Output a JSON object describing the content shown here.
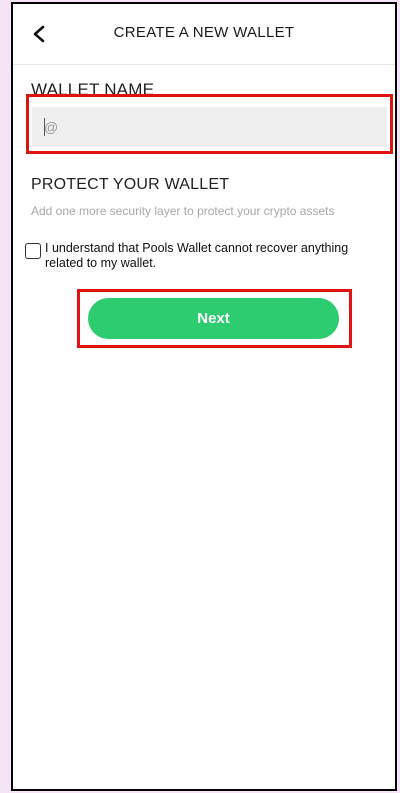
{
  "header": {
    "title": "CREATE A NEW WALLET",
    "back_icon": "chevron-left-icon"
  },
  "wallet_name": {
    "label": "WALLET NAME",
    "value": "",
    "placeholder": "@"
  },
  "protect": {
    "title": "PROTECT YOUR WALLET",
    "subtitle": "Add one more security layer to protect your crypto assets"
  },
  "agreement": {
    "checked": false,
    "label": "I understand that Pools Wallet cannot recover anything related to my wallet."
  },
  "actions": {
    "next_label": "Next"
  },
  "colors": {
    "accent": "#2ecc71",
    "highlight": "#e01313"
  }
}
